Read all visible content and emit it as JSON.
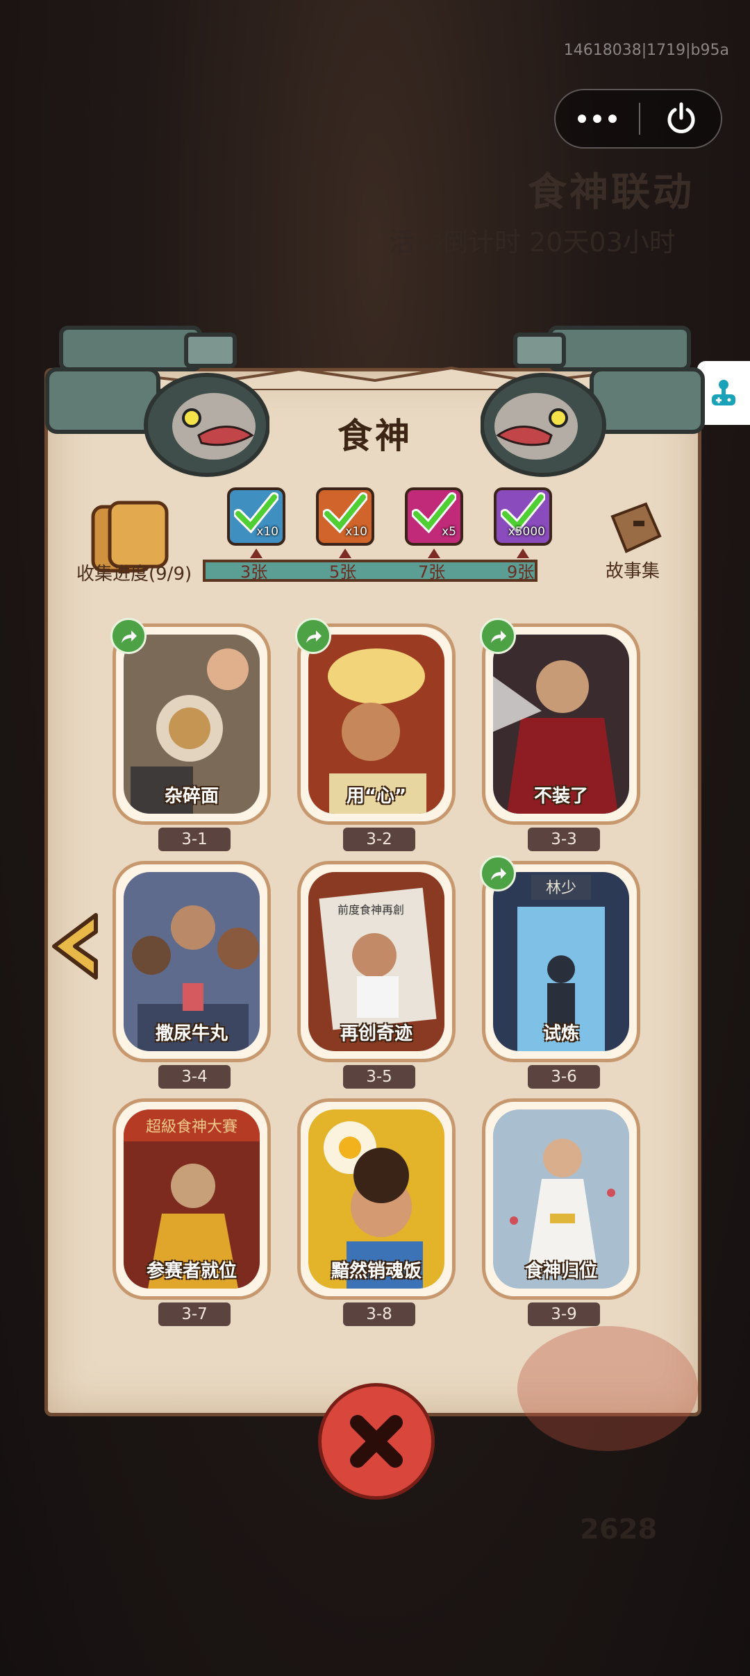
{
  "build_id": "14618038|1719|b95a",
  "background": {
    "event_title": "食神联动",
    "event_timer": "活动倒计时 20天03小时",
    "score": "2628"
  },
  "capsule": {
    "more_icon": "more-dots-icon",
    "close_icon": "power-icon"
  },
  "side_tab_icon": "game-controller-icon",
  "panel": {
    "title": "食神",
    "collect_label": "收集进度(9/9)",
    "story_label": "故事集",
    "rewards": [
      {
        "qty": "x10",
        "color": "#3f8fc1"
      },
      {
        "qty": "x10",
        "color": "#d0642a"
      },
      {
        "qty": "x5",
        "color": "#c02a78"
      },
      {
        "qty": "x5000",
        "color": "#8a4bbd"
      }
    ],
    "ticks": [
      "3张",
      "5张",
      "7张",
      "9张"
    ],
    "progress": 1.0
  },
  "cards": [
    {
      "title": "杂碎面",
      "num": "3-1",
      "shared": true
    },
    {
      "title": "用“心”",
      "num": "3-2",
      "shared": true
    },
    {
      "title": "不装了",
      "num": "3-3",
      "shared": true
    },
    {
      "title": "撒尿牛丸",
      "num": "3-4",
      "shared": false
    },
    {
      "title": "再创奇迹",
      "num": "3-5",
      "shared": false
    },
    {
      "title": "试炼",
      "num": "3-6",
      "shared": true
    },
    {
      "title": "参赛者就位",
      "num": "3-7",
      "shared": false
    },
    {
      "title": "黯然销魂饭",
      "num": "3-8",
      "shared": false
    },
    {
      "title": "食神归位",
      "num": "3-9",
      "shared": false
    }
  ],
  "card_art_text": {
    "3-6_sign": "林少",
    "3-7_banner": "超級食神大賽",
    "3-5_headline": "前度食神再創"
  }
}
